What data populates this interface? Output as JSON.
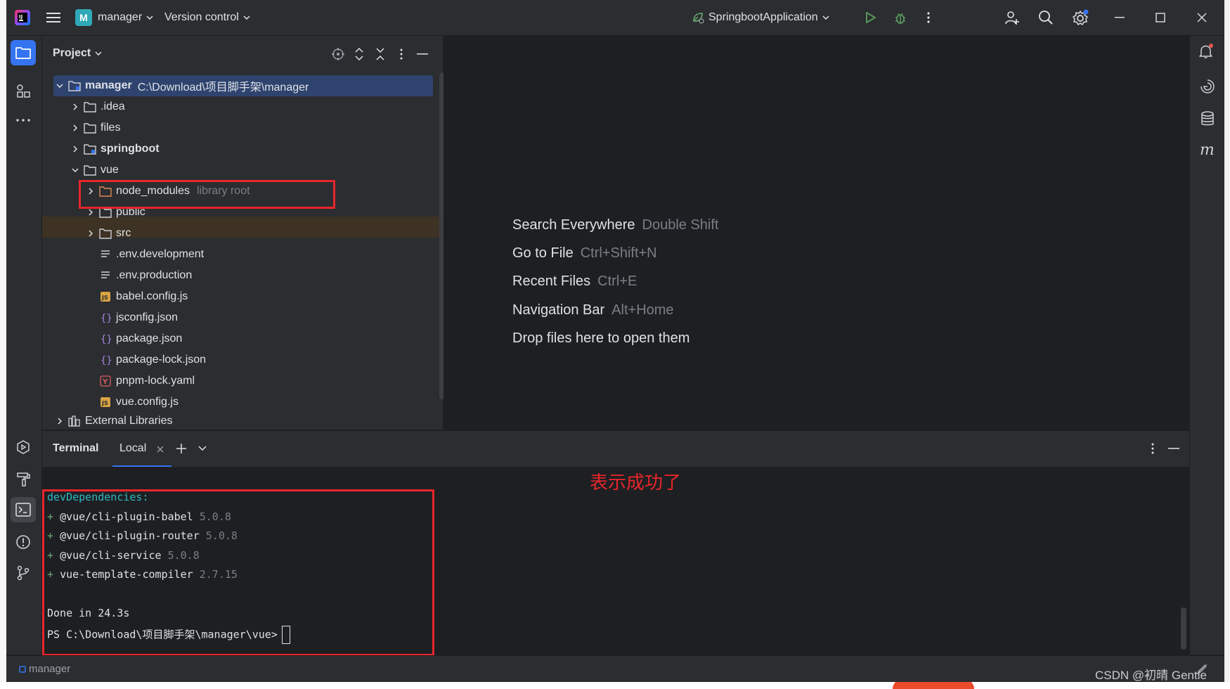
{
  "titlebar": {
    "project_badge": "M",
    "project_name": "manager",
    "version_control": "Version control",
    "run_config": "SpringbootApplication"
  },
  "project_panel": {
    "title": "Project",
    "tree": [
      {
        "label": "manager",
        "path": "C:\\Download\\项目脚手架\\manager",
        "bold": true
      },
      {
        "label": ".idea"
      },
      {
        "label": "files"
      },
      {
        "label": "springboot",
        "bold": true
      },
      {
        "label": "vue"
      },
      {
        "label": "node_modules",
        "hint": "library root"
      },
      {
        "label": "public"
      },
      {
        "label": "src"
      },
      {
        "label": ".env.development"
      },
      {
        "label": ".env.production"
      },
      {
        "label": "babel.config.js"
      },
      {
        "label": "jsconfig.json"
      },
      {
        "label": "package.json"
      },
      {
        "label": "package-lock.json"
      },
      {
        "label": "pnpm-lock.yaml"
      },
      {
        "label": "vue.config.js"
      },
      {
        "label": "External Libraries"
      }
    ]
  },
  "welcome": [
    {
      "label": "Search Everywhere",
      "key": "Double Shift"
    },
    {
      "label": "Go to File",
      "key": "Ctrl+Shift+N"
    },
    {
      "label": "Recent Files",
      "key": "Ctrl+E"
    },
    {
      "label": "Navigation Bar",
      "key": "Alt+Home"
    },
    {
      "label": "Drop files here to open them",
      "key": ""
    }
  ],
  "terminal": {
    "title": "Terminal",
    "tab": "Local",
    "header": "devDependencies:",
    "deps": [
      {
        "plus": "+",
        "name": "@vue/cli-plugin-babel",
        "version": "5.0.8"
      },
      {
        "plus": "+",
        "name": "@vue/cli-plugin-router",
        "version": "5.0.8"
      },
      {
        "plus": "+",
        "name": "@vue/cli-service",
        "version": "5.0.8"
      },
      {
        "plus": "+",
        "name": "vue-template-compiler",
        "version": "2.7.15"
      }
    ],
    "done": "Done in 24.3s",
    "prompt": "PS C:\\Download\\项目脚手架\\manager\\vue>"
  },
  "annotation": "表示成功了",
  "statusbar": {
    "project": "manager"
  },
  "watermark": "CSDN @初晴 Gentle"
}
